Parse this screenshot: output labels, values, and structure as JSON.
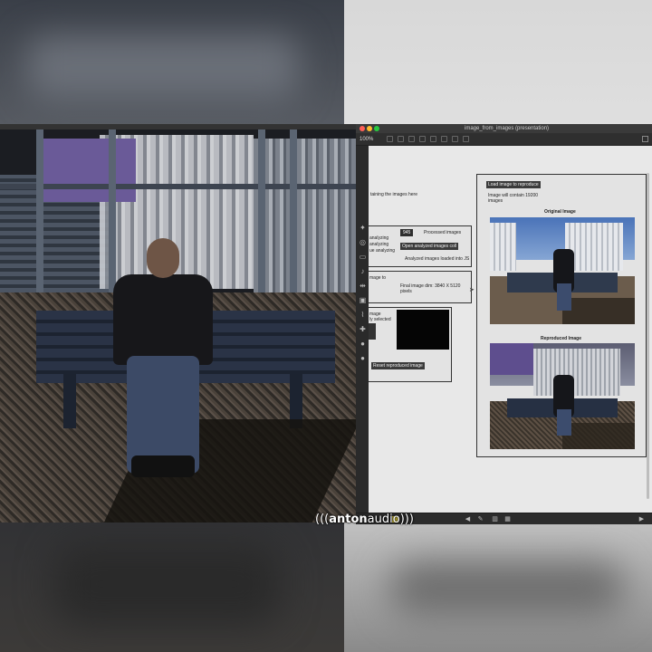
{
  "window": {
    "title": "image_from_images (presentation)",
    "zoom": "100%"
  },
  "left_text": {
    "line1": "taining the images here",
    "analyzing1": "analyzing",
    "analyzing2": "analyzing",
    "analyzing3": "ue analyzing",
    "image_to": "mage to",
    "image_sel1": "mage",
    "image_sel2": "ly selected"
  },
  "processing": {
    "count": "945",
    "processed_label": "Processed images",
    "open_button": "Open analyzed images coll",
    "loaded_text": "Analyzed images loaded into JS",
    "final_dim": "Final image dim: 3840 X 5120",
    "final_dim2": "pixels",
    "reset_button": "Reset reproduced image"
  },
  "right_panel": {
    "load_button": "Load image to reproduce",
    "contain_text1": "Image will contain 19200",
    "contain_text2": "images",
    "original_label": "Original Image",
    "reproduced_label": "Reproduced Image"
  },
  "watermark": {
    "prefix": "(((",
    "bold": "anton",
    "rest": "audio",
    "suffix": ")))"
  },
  "colors": {
    "close": "#ff5f57",
    "minimize": "#febc2e",
    "maximize": "#28c840",
    "canvas_bg": "#e8e8e8"
  }
}
